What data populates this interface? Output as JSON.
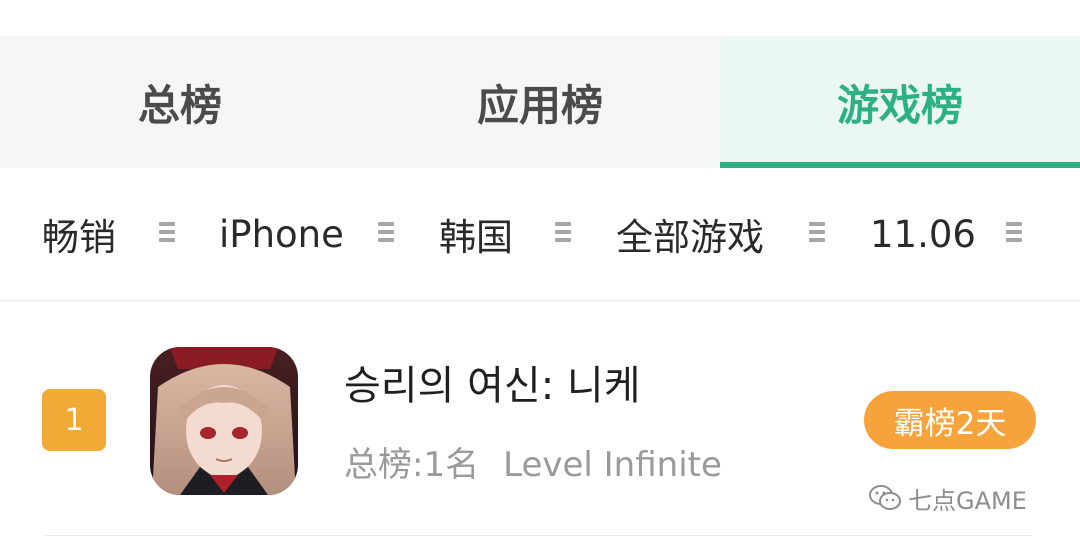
{
  "tabs": [
    {
      "label": "总榜",
      "active": false
    },
    {
      "label": "应用榜",
      "active": false
    },
    {
      "label": "游戏榜",
      "active": true
    }
  ],
  "filters": [
    {
      "label": "畅销",
      "icon": "menu-icon"
    },
    {
      "label": "iPhone",
      "icon": "menu-icon"
    },
    {
      "label": "韩国",
      "icon": "menu-icon"
    },
    {
      "label": "全部游戏",
      "icon": "menu-icon"
    },
    {
      "label": "11.06",
      "icon": "menu-icon"
    }
  ],
  "rankings": [
    {
      "rank": "1",
      "name": "승리의 여신: 니케",
      "overall_rank": "总榜:1名",
      "developer": "Level Infinite",
      "badge": "霸榜2天"
    }
  ],
  "watermark": {
    "text": "七点GAME",
    "icon": "wechat-icon"
  },
  "colors": {
    "accent": "#2db084",
    "active_tab_bg": "#eaf7f2",
    "rank_badge": "#f3a936",
    "streak_badge": "#f5a33a"
  }
}
